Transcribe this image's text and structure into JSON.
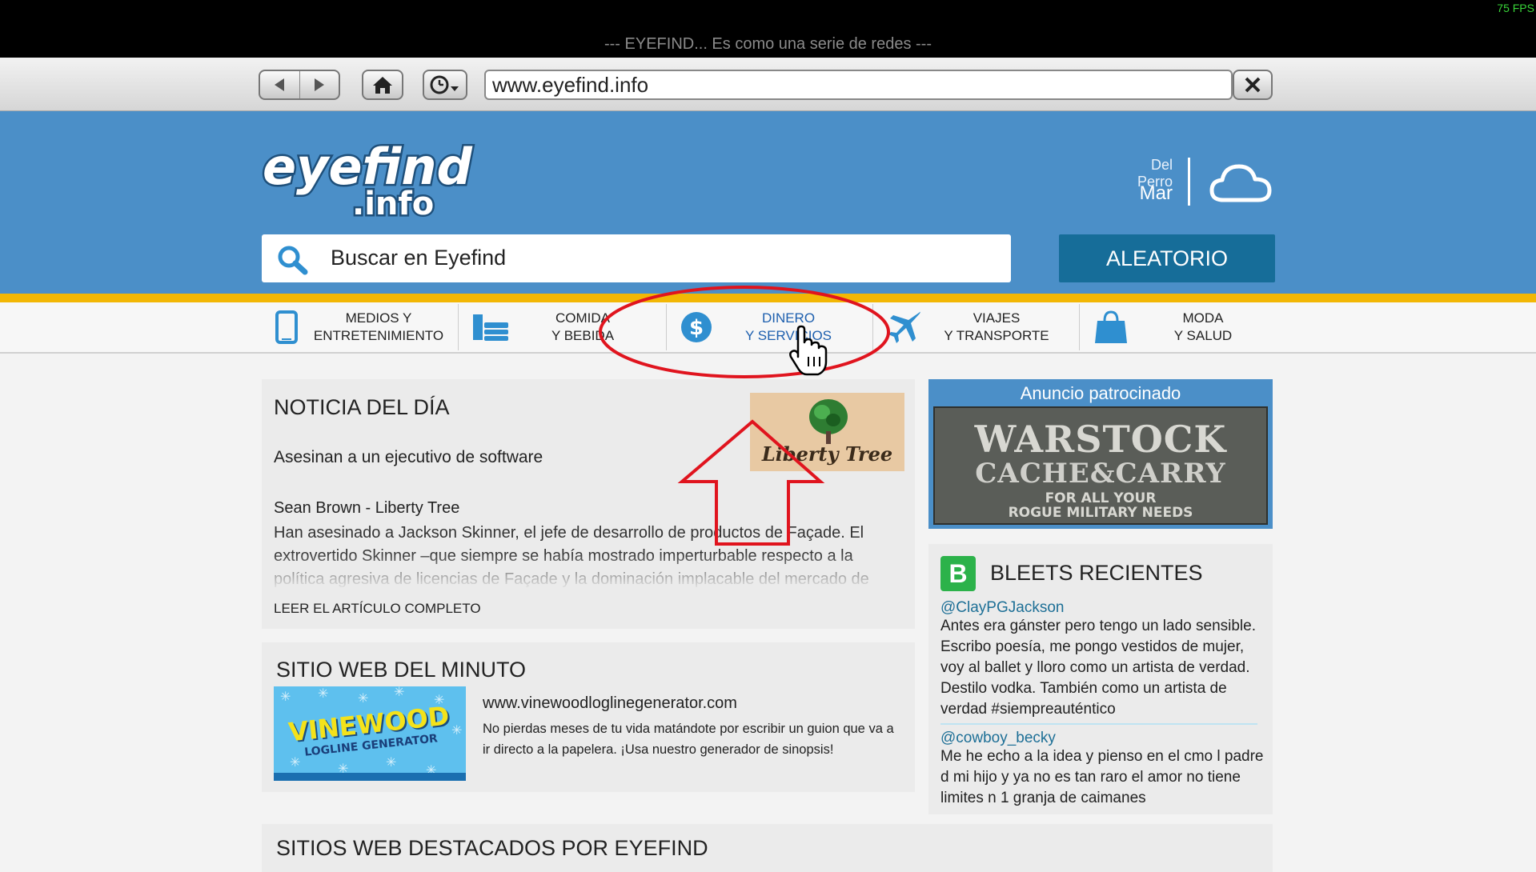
{
  "window": {
    "title": "--- EYEFIND... Es como una serie de redes ---",
    "fps": "75 FPS"
  },
  "browser": {
    "url": "www.eyefind.info"
  },
  "header": {
    "logo_word": "eyefind",
    "logo_domain": ".info",
    "weather_location": "Del Perro",
    "weather_day": "Mar",
    "search_placeholder": "Buscar en Eyefind",
    "random_label": "ALEATORIO"
  },
  "categories": [
    {
      "line1": "MEDIOS Y",
      "line2": "ENTRETENIMIENTO",
      "icon": "phone-icon"
    },
    {
      "line1": "COMIDA",
      "line2": "Y BEBIDA",
      "icon": "food-icon"
    },
    {
      "line1": "DINERO",
      "line2": "Y SERVICIOS",
      "icon": "dollar-icon"
    },
    {
      "line1": "VIAJES",
      "line2": "Y TRANSPORTE",
      "icon": "airplane-icon"
    },
    {
      "line1": "MODA",
      "line2": "Y SALUD",
      "icon": "shopping-bag-icon"
    }
  ],
  "news": {
    "heading": "NOTICIA DEL DÍA",
    "headline": "Asesinan a un ejecutivo de software",
    "byline": "Sean Brown - Liberty Tree",
    "body": "Han asesinado a Jackson Skinner, el jefe de desarrollo de productos de Façade. El extrovertido Skinner –que siempre se había mostrado imperturbable respecto a la política agresiva de licencias de Façade y la dominación implacable del mercado de",
    "read_more": "LEER EL ARTÍCULO COMPLETO",
    "source_logo": "Liberty Tree"
  },
  "minute": {
    "heading": "SITIO WEB DEL MINUTO",
    "thumb_title": "VINEWOOD",
    "thumb_sub": "LOGLINE GENERATOR",
    "url": "www.vinewoodloglinegenerator.com",
    "desc": "No pierdas meses de tu vida matándote por escribir un guion que va a ir directo a la papelera. ¡Usa nuestro generador de sinopsis!"
  },
  "featured": {
    "heading": "SITIOS WEB DESTACADOS POR EYEFIND"
  },
  "ad": {
    "label": "Anuncio patrocinado",
    "line1": "WARSTOCK",
    "line2": "CACHE&CARRY",
    "line3": "FOR ALL YOUR",
    "line4": "ROGUE MILITARY NEEDS"
  },
  "bleets": {
    "heading": "BLEETS RECIENTES",
    "icon_letter": "B",
    "items": [
      {
        "user": "@ClayPGJackson",
        "text": "Antes era gánster pero tengo un lado sensible. Escribo poesía, me pongo vestidos de mujer, voy al ballet y lloro como un artista de verdad. Destilo vodka. También como un artista de verdad #siempreauténtico"
      },
      {
        "user": "@cowboy_becky",
        "text": "Me he echo a la idea y pienso en el cmo l padre d mi hijo y ya no es tan raro el amor no tiene limites n 1 granja de caimanes"
      }
    ]
  },
  "colors": {
    "header_blue": "#4b8fc8",
    "accent_yellow": "#f2b705",
    "button_blue": "#166d99",
    "annotation_red": "#e0141e"
  }
}
